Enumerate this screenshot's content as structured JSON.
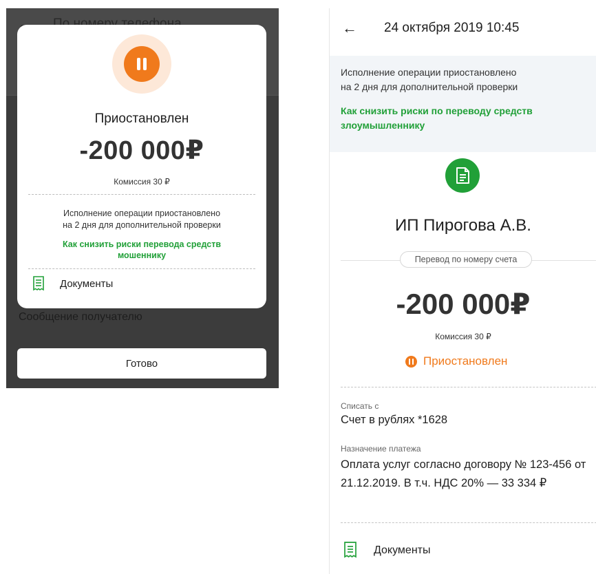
{
  "left": {
    "bg_title": "По номеру телефона",
    "bg_message_label": "Сообщение получателю",
    "done_button": "Готово",
    "modal": {
      "status": "Приостановлен",
      "amount": "-200 000₽",
      "fee": "Комиссия 30 ₽",
      "info_line1": "Исполнение операции приостановлено",
      "info_line2": "на 2 дня для дополнительной проверки",
      "link_line1": "Как снизить риски перевода средств",
      "link_line2": "мошеннику",
      "documents": "Документы"
    }
  },
  "right": {
    "date": "24 октября 2019 10:45",
    "banner": {
      "line1": "Исполнение операции приостановлено",
      "line2": "на 2 дня для дополнительной проверки",
      "link_line1": "Как снизить риски по переводу средств",
      "link_line2": "злоумышленнику"
    },
    "recipient": "ИП Пирогова А.В.",
    "transfer_type": "Перевод по номеру счета",
    "amount": "-200 000₽",
    "fee": "Комиссия 30 ₽",
    "status": "Приостановлен",
    "debit_label": "Списать с",
    "debit_value": "Счет в рублях *1628",
    "purpose_label": "Назначение платежа",
    "purpose_value": "Оплата услуг согласно договору № 123-456 от 21.12.2019. В т.ч. НДС 20% — 33 334 ₽",
    "documents": "Документы"
  },
  "colors": {
    "accent_green": "#21a038",
    "status_orange": "#f07a1c",
    "overlay_dark": "#3c3c3c",
    "banner_bg": "#f2f5f8"
  },
  "icons": [
    "back-arrow-icon",
    "pause-icon",
    "document-icon",
    "receipt-icon"
  ]
}
